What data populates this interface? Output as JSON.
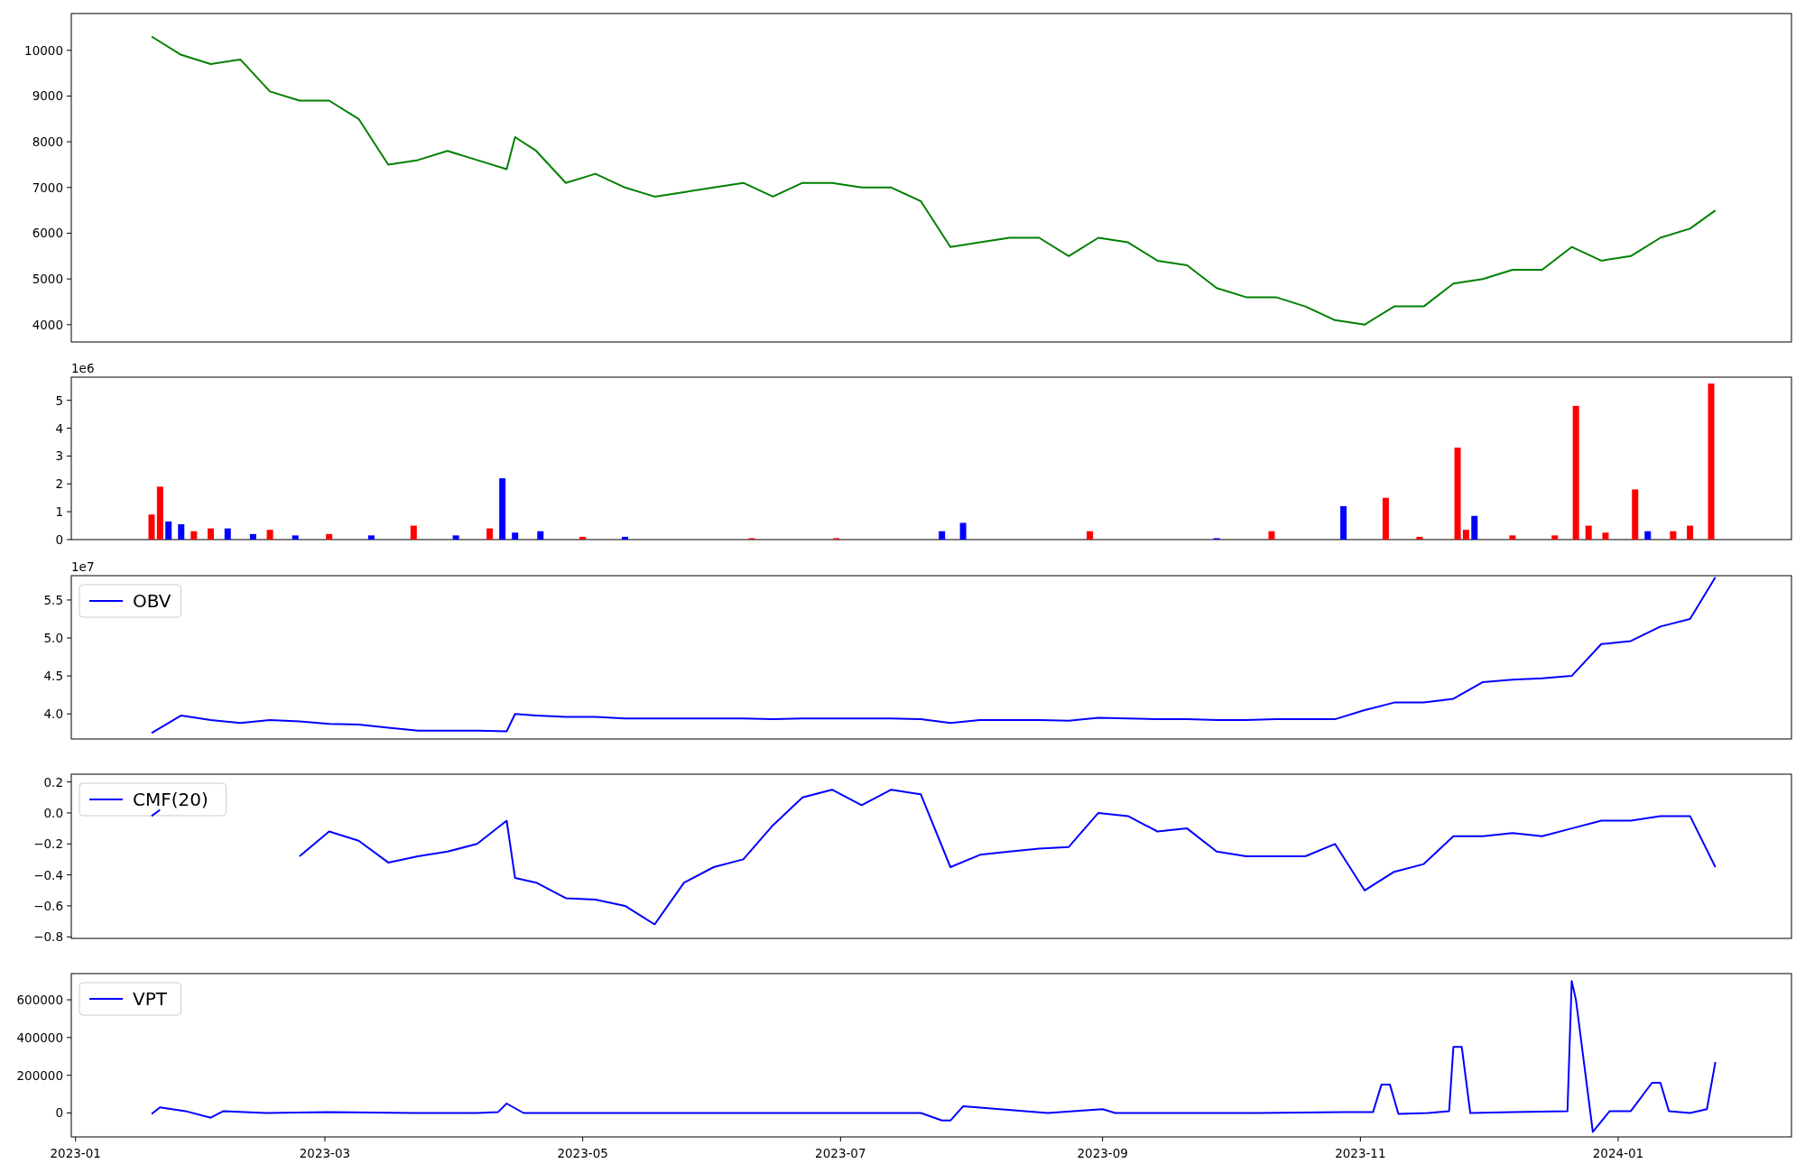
{
  "charts": [
    {
      "chart_data": {
        "type": "line",
        "x": [
          "2023-01-19",
          "2023-01-26",
          "2023-02-02",
          "2023-02-09",
          "2023-02-16",
          "2023-02-23",
          "2023-03-02",
          "2023-03-09",
          "2023-03-16",
          "2023-03-23",
          "2023-03-30",
          "2023-04-06",
          "2023-04-13",
          "2023-04-15",
          "2023-04-20",
          "2023-04-27",
          "2023-05-04",
          "2023-05-11",
          "2023-05-18",
          "2023-05-25",
          "2023-06-01",
          "2023-06-08",
          "2023-06-15",
          "2023-06-22",
          "2023-06-29",
          "2023-07-06",
          "2023-07-13",
          "2023-07-20",
          "2023-07-27",
          "2023-08-03",
          "2023-08-10",
          "2023-08-17",
          "2023-08-24",
          "2023-08-31",
          "2023-09-07",
          "2023-09-14",
          "2023-09-21",
          "2023-09-28",
          "2023-10-05",
          "2023-10-12",
          "2023-10-19",
          "2023-10-26",
          "2023-11-02",
          "2023-11-09",
          "2023-11-16",
          "2023-11-23",
          "2023-11-30",
          "2023-12-07",
          "2023-12-14",
          "2023-12-21",
          "2023-12-28",
          "2024-01-04",
          "2024-01-11",
          "2024-01-18",
          "2024-01-24"
        ],
        "xlim": [
          "2022-12-31",
          "2024-02-11"
        ],
        "ylim": [
          3622,
          10804
        ],
        "yticks": [
          4000,
          5000,
          6000,
          7000,
          8000,
          9000,
          10000
        ],
        "series": [
          {
            "color": "#008000",
            "values": [
              10300,
              9900,
              9700,
              9800,
              9100,
              8900,
              8900,
              8500,
              7500,
              7600,
              7800,
              7600,
              7400,
              8100,
              7800,
              7100,
              7300,
              7000,
              6800,
              6900,
              7000,
              7100,
              6800,
              7100,
              7100,
              7000,
              7000,
              6700,
              5700,
              5800,
              5900,
              5900,
              5500,
              5900,
              5800,
              5400,
              5300,
              4800,
              4600,
              4600,
              4400,
              4100,
              4000,
              4400,
              4400,
              4900,
              5000,
              5200,
              5200,
              5700,
              5400,
              5500,
              5900,
              6100,
              6500
            ]
          }
        ]
      }
    },
    {
      "chart_data": {
        "type": "bar",
        "x": [
          "2023-01-19",
          "2023-01-21",
          "2023-01-23",
          "2023-01-26",
          "2023-01-29",
          "2023-02-02",
          "2023-02-06",
          "2023-02-12",
          "2023-02-16",
          "2023-02-22",
          "2023-03-02",
          "2023-03-12",
          "2023-03-22",
          "2023-04-01",
          "2023-04-09",
          "2023-04-12",
          "2023-04-15",
          "2023-04-21",
          "2023-05-01",
          "2023-05-11",
          "2023-06-10",
          "2023-06-30",
          "2023-07-25",
          "2023-07-30",
          "2023-08-29",
          "2023-09-28",
          "2023-10-11",
          "2023-10-28",
          "2023-11-07",
          "2023-11-15",
          "2023-11-24",
          "2023-11-26",
          "2023-11-28",
          "2023-12-07",
          "2023-12-17",
          "2023-12-22",
          "2023-12-25",
          "2023-12-29",
          "2024-01-05",
          "2024-01-08",
          "2024-01-14",
          "2024-01-18",
          "2024-01-23"
        ],
        "xlim": [
          "2022-12-31",
          "2024-02-11"
        ],
        "ylim": [
          0,
          5.83
        ],
        "yticks": [
          0,
          1,
          2,
          3,
          4,
          5
        ],
        "annotations": [
          {
            "text": "1e6"
          }
        ],
        "series": [
          {
            "color": "#ff0000",
            "values": [
              0.9,
              1.9,
              null,
              null,
              0.3,
              0.4,
              null,
              null,
              0.35,
              null,
              0.2,
              null,
              0.5,
              null,
              0.4,
              null,
              null,
              null,
              0.1,
              null,
              0.05,
              0.05,
              null,
              null,
              0.3,
              null,
              0.3,
              null,
              1.5,
              0.1,
              3.3,
              0.35,
              null,
              0.15,
              0.15,
              4.8,
              0.5,
              0.25,
              1.8,
              null,
              0.3,
              0.5,
              5.6
            ]
          },
          {
            "color": "#0000ff",
            "values": [
              null,
              null,
              0.65,
              0.55,
              null,
              null,
              0.4,
              0.2,
              null,
              0.15,
              null,
              0.15,
              null,
              0.15,
              null,
              2.2,
              0.25,
              0.3,
              null,
              0.1,
              null,
              null,
              0.3,
              0.6,
              null,
              0.05,
              null,
              1.2,
              null,
              null,
              null,
              null,
              0.85,
              null,
              null,
              null,
              null,
              null,
              null,
              0.3,
              null,
              null,
              null
            ]
          }
        ]
      }
    },
    {
      "chart_data": {
        "type": "line",
        "x": [
          "2023-01-19",
          "2023-01-26",
          "2023-02-02",
          "2023-02-09",
          "2023-02-16",
          "2023-02-23",
          "2023-03-02",
          "2023-03-09",
          "2023-03-16",
          "2023-03-23",
          "2023-03-30",
          "2023-04-06",
          "2023-04-13",
          "2023-04-15",
          "2023-04-20",
          "2023-04-27",
          "2023-05-04",
          "2023-05-11",
          "2023-05-18",
          "2023-05-25",
          "2023-06-01",
          "2023-06-08",
          "2023-06-15",
          "2023-06-22",
          "2023-06-29",
          "2023-07-06",
          "2023-07-13",
          "2023-07-20",
          "2023-07-27",
          "2023-08-03",
          "2023-08-10",
          "2023-08-17",
          "2023-08-24",
          "2023-08-31",
          "2023-09-07",
          "2023-09-14",
          "2023-09-21",
          "2023-09-28",
          "2023-10-05",
          "2023-10-12",
          "2023-10-19",
          "2023-10-26",
          "2023-11-02",
          "2023-11-09",
          "2023-11-16",
          "2023-11-23",
          "2023-11-30",
          "2023-12-07",
          "2023-12-14",
          "2023-12-21",
          "2023-12-28",
          "2024-01-04",
          "2024-01-11",
          "2024-01-18",
          "2024-01-24"
        ],
        "xlim": [
          "2022-12-31",
          "2024-02-11"
        ],
        "ylim": [
          3.67,
          5.82
        ],
        "yticks": [
          {
            "value": 4,
            "label": "4.0"
          },
          {
            "value": 4.5,
            "label": "4.5"
          },
          {
            "value": 5,
            "label": "5.0"
          },
          {
            "value": 5.5,
            "label": "5.5"
          }
        ],
        "annotations": [
          {
            "text": "1e7"
          }
        ],
        "series": [
          {
            "name": "OBV",
            "color": "#0000ff",
            "values": [
              3.75,
              3.98,
              3.92,
              3.88,
              3.92,
              3.9,
              3.87,
              3.86,
              3.82,
              3.78,
              3.78,
              3.78,
              3.77,
              4.0,
              3.98,
              3.96,
              3.96,
              3.94,
              3.94,
              3.94,
              3.94,
              3.94,
              3.93,
              3.94,
              3.94,
              3.94,
              3.94,
              3.93,
              3.88,
              3.92,
              3.92,
              3.92,
              3.91,
              3.95,
              3.94,
              3.93,
              3.93,
              3.92,
              3.92,
              3.93,
              3.93,
              3.93,
              4.05,
              4.15,
              4.15,
              4.2,
              4.42,
              4.45,
              4.47,
              4.5,
              4.92,
              4.96,
              5.15,
              5.25,
              5.8
            ]
          }
        ]
      }
    },
    {
      "chart_data": {
        "type": "line",
        "x": [
          "2023-01-19",
          "2023-01-21",
          "2023-02-06",
          "2023-02-23",
          "2023-03-02",
          "2023-03-09",
          "2023-03-16",
          "2023-03-23",
          "2023-03-30",
          "2023-04-06",
          "2023-04-13",
          "2023-04-15",
          "2023-04-20",
          "2023-04-27",
          "2023-05-04",
          "2023-05-11",
          "2023-05-18",
          "2023-05-25",
          "2023-06-01",
          "2023-06-08",
          "2023-06-15",
          "2023-06-22",
          "2023-06-29",
          "2023-07-06",
          "2023-07-13",
          "2023-07-20",
          "2023-07-27",
          "2023-08-03",
          "2023-08-10",
          "2023-08-17",
          "2023-08-24",
          "2023-08-31",
          "2023-09-07",
          "2023-09-14",
          "2023-09-21",
          "2023-09-28",
          "2023-10-05",
          "2023-10-12",
          "2023-10-19",
          "2023-10-26",
          "2023-11-02",
          "2023-11-09",
          "2023-11-16",
          "2023-11-23",
          "2023-11-30",
          "2023-12-07",
          "2023-12-14",
          "2023-12-21",
          "2023-12-28",
          "2024-01-04",
          "2024-01-11",
          "2024-01-18",
          "2024-01-24"
        ],
        "xlim": [
          "2022-12-31",
          "2024-02-11"
        ],
        "ylim": [
          -0.81,
          0.25
        ],
        "yticks": [
          {
            "value": -0.8,
            "label": "−0.8"
          },
          {
            "value": -0.6,
            "label": "−0.6"
          },
          {
            "value": -0.4,
            "label": "−0.4"
          },
          {
            "value": -0.2,
            "label": "−0.2"
          },
          {
            "value": 0,
            "label": "0.0"
          },
          {
            "value": 0.2,
            "label": "0.2"
          }
        ],
        "series": [
          {
            "name": "CMF(20)",
            "color": "#0000ff",
            "values": [
              -0.02,
              0.02,
              null,
              -0.28,
              -0.12,
              -0.18,
              -0.32,
              -0.28,
              -0.25,
              -0.2,
              -0.05,
              -0.42,
              -0.45,
              -0.55,
              -0.56,
              -0.6,
              -0.72,
              -0.45,
              -0.35,
              -0.3,
              -0.08,
              0.1,
              0.15,
              0.05,
              0.15,
              0.12,
              -0.35,
              -0.27,
              -0.25,
              -0.23,
              -0.22,
              0.0,
              -0.02,
              -0.12,
              -0.1,
              -0.25,
              -0.28,
              -0.28,
              -0.28,
              -0.2,
              -0.5,
              -0.38,
              -0.33,
              -0.15,
              -0.15,
              -0.13,
              -0.15,
              -0.1,
              -0.05,
              -0.05,
              -0.02,
              -0.02,
              -0.35
            ]
          }
        ]
      }
    },
    {
      "chart_data": {
        "type": "line",
        "x": [
          "2023-01-19",
          "2023-01-21",
          "2023-01-27",
          "2023-02-02",
          "2023-02-05",
          "2023-02-15",
          "2023-03-02",
          "2023-03-22",
          "2023-04-06",
          "2023-04-11",
          "2023-04-13",
          "2023-04-17",
          "2023-05-11",
          "2023-06-30",
          "2023-07-20",
          "2023-07-25",
          "2023-07-27",
          "2023-07-30",
          "2023-08-19",
          "2023-09-01",
          "2023-09-04",
          "2023-10-08",
          "2023-10-28",
          "2023-11-04",
          "2023-11-06",
          "2023-11-08",
          "2023-11-10",
          "2023-11-17",
          "2023-11-22",
          "2023-11-23",
          "2023-11-25",
          "2023-11-27",
          "2023-12-07",
          "2023-12-20",
          "2023-12-21",
          "2023-12-22",
          "2023-12-26",
          "2023-12-30",
          "2024-01-04",
          "2024-01-09",
          "2024-01-11",
          "2024-01-13",
          "2024-01-18",
          "2024-01-22",
          "2024-01-24"
        ],
        "xlim": [
          "2022-12-31",
          "2024-02-11"
        ],
        "ylim": [
          -127000,
          739000
        ],
        "yticks": [
          0,
          200000,
          400000,
          600000
        ],
        "xticks": [
          {
            "value": "2023-01-01",
            "label": "2023-01"
          },
          {
            "value": "2023-03-01",
            "label": "2023-03"
          },
          {
            "value": "2023-05-01",
            "label": "2023-05"
          },
          {
            "value": "2023-07-01",
            "label": "2023-07"
          },
          {
            "value": "2023-09-01",
            "label": "2023-09"
          },
          {
            "value": "2023-11-01",
            "label": "2023-11"
          },
          {
            "value": "2024-01-01",
            "label": "2024-01"
          }
        ],
        "series": [
          {
            "name": "VPT",
            "color": "#0000ff",
            "values": [
              -5000,
              30000,
              10000,
              -25000,
              10000,
              0,
              5000,
              0,
              0,
              5000,
              50000,
              0,
              0,
              0,
              0,
              -40000,
              -40000,
              35000,
              0,
              20000,
              0,
              0,
              5000,
              5000,
              150000,
              150000,
              -5000,
              0,
              10000,
              350000,
              350000,
              0,
              5000,
              10000,
              700000,
              600000,
              -100000,
              10000,
              10000,
              160000,
              160000,
              10000,
              0,
              20000,
              270000
            ]
          }
        ]
      }
    }
  ]
}
